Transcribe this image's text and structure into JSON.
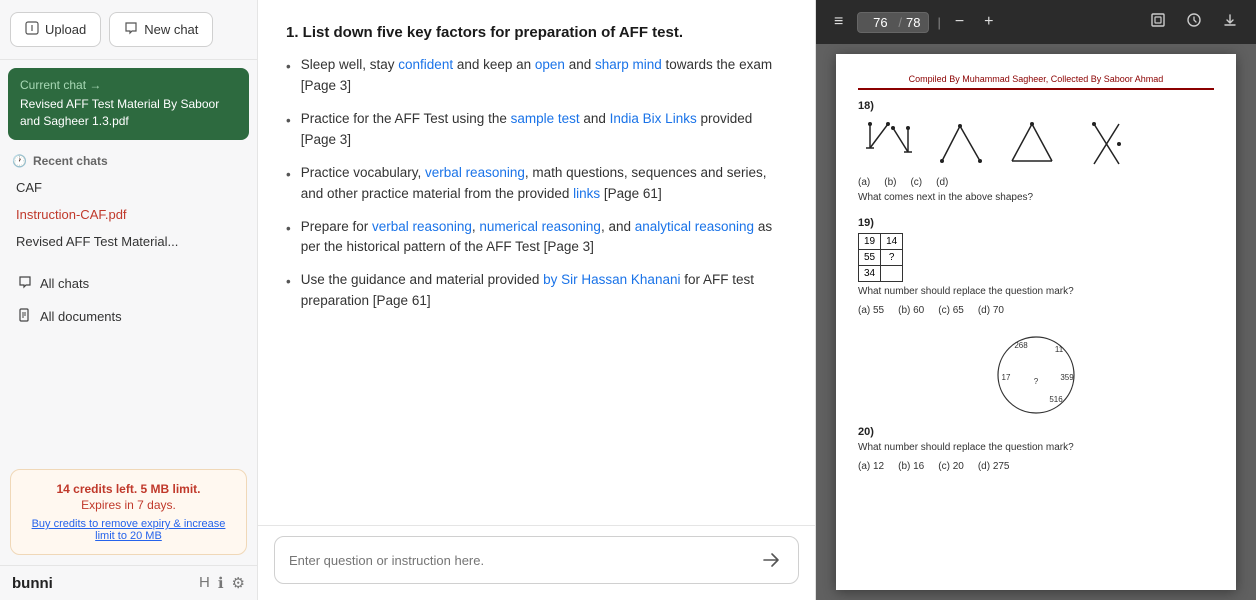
{
  "sidebar": {
    "upload_label": "Upload",
    "new_chat_label": "New chat",
    "current_chat": {
      "label": "Current chat →",
      "title": "Revised AFF Test Material By Saboor and Sagheer 1.3.pdf"
    },
    "recent_section_label": "Recent chats",
    "recent_items": [
      {
        "label": "CAF",
        "active": false
      },
      {
        "label": "Instruction-CAF.pdf",
        "active": true
      },
      {
        "label": "Revised AFF Test Material...",
        "active": false
      }
    ],
    "nav_links": [
      {
        "label": "All chats",
        "icon": "chat-icon"
      },
      {
        "label": "All documents",
        "icon": "doc-icon"
      }
    ],
    "credits": {
      "main": "14 credits left. 5 MB limit.",
      "expiry": "Expires in 7 days.",
      "link_text": "Buy credits to remove expiry & increase limit to 20 MB"
    },
    "brand": "bunni"
  },
  "chat": {
    "question": "1. List down five key factors for preparation of AFF test.",
    "answers": [
      "Sleep well, stay confident and keep an open and sharp mind towards the exam [Page 3]",
      "Practice for the AFF Test using the sample test and India Bix Links provided [Page 3]",
      "Practice vocabulary, verbal reasoning, math questions, sequences and series, and other practice material from the provided links [Page 61]",
      "Prepare for verbal reasoning, numerical reasoning, and analytical reasoning as per the historical pattern of the AFF Test [Page 3]",
      "Use the guidance and material provided by Sir Hassan Khanani for AFF test preparation [Page 61]"
    ],
    "input_placeholder": "Enter question or instruction here."
  },
  "pdf": {
    "toolbar": {
      "menu_icon": "≡",
      "page_current": "76",
      "page_total": "78",
      "zoom_out_icon": "−",
      "zoom_in_icon": "+",
      "fit_icon": "⊡",
      "history_icon": "⟳",
      "download_icon": "↓"
    },
    "content": {
      "compiled_by": "Compiled By Muhammad Sagheer, Collected By Saboor Ahmad",
      "q18": {
        "num": "18)",
        "text": "What comes next in the above shapes?",
        "shapes": [
          {
            "label": "(a)",
            "type": "lines-a"
          },
          {
            "label": "(b)",
            "type": "lines-b"
          },
          {
            "label": "(c)",
            "type": "lines-c"
          },
          {
            "label": "(d)",
            "type": "lines-d"
          }
        ]
      },
      "q19": {
        "num": "19)",
        "text": "What number should replace the question mark?",
        "grid": [
          [
            "19",
            "14"
          ],
          [
            "55",
            "?"
          ],
          [
            "34",
            ""
          ]
        ],
        "options": [
          "(a) 55",
          "(b) 60",
          "(c) 65",
          "(d) 70"
        ]
      },
      "q20": {
        "num": "20)",
        "text": "What number should replace the question mark?",
        "circle_numbers": [
          "268",
          "11",
          "359",
          "17",
          "?",
          "516"
        ],
        "options": [
          "(a) 12",
          "(b) 16",
          "(c) 20",
          "(d) 275"
        ]
      }
    }
  }
}
